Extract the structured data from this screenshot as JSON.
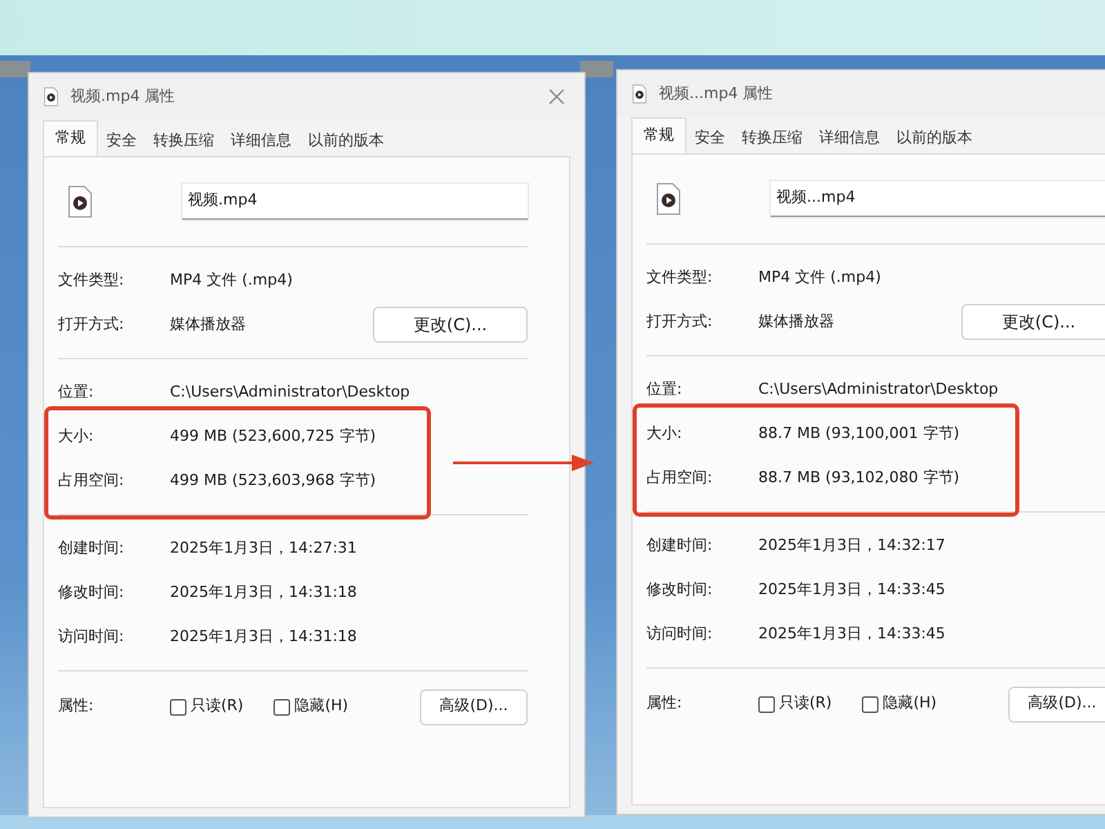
{
  "windows": [
    {
      "title": "视频.mp4 属性",
      "close_visible": true,
      "tabs": [
        {
          "label": "常规",
          "selected": true
        },
        {
          "label": "安全",
          "selected": false
        },
        {
          "label": "转换压缩",
          "selected": false
        },
        {
          "label": "详细信息",
          "selected": false
        },
        {
          "label": "以前的版本",
          "selected": false
        }
      ],
      "file_name": "视频.mp4",
      "sections": [
        [
          {
            "label": "文件类型:",
            "value": "MP4 文件 (.mp4)",
            "highlighted": false
          },
          {
            "label": "打开方式:",
            "value": "媒体播放器",
            "button": "更改(C)...",
            "highlighted": false
          }
        ],
        [
          {
            "label": "位置:",
            "value": "C:\\Users\\Administrator\\Desktop",
            "highlighted": false
          },
          {
            "label": "大小:",
            "value": "499 MB (523,600,725 字节)",
            "highlighted": true
          },
          {
            "label": "占用空间:",
            "value": "499 MB (523,603,968 字节)",
            "highlighted": true
          }
        ],
        [
          {
            "label": "创建时间:",
            "value": "2025年1月3日，14:27:31",
            "highlighted": false
          },
          {
            "label": "修改时间:",
            "value": "2025年1月3日，14:31:18",
            "highlighted": false
          },
          {
            "label": "访问时间:",
            "value": "2025年1月3日，14:31:18",
            "highlighted": false
          }
        ]
      ],
      "attributes": {
        "label": "属性:",
        "checkboxes": [
          {
            "label": "只读(R)",
            "checked": false
          },
          {
            "label": "隐藏(H)",
            "checked": false
          }
        ],
        "button": "高级(D)..."
      }
    },
    {
      "title": "视频...mp4 属性",
      "close_visible": false,
      "tabs": [
        {
          "label": "常规",
          "selected": true
        },
        {
          "label": "安全",
          "selected": false
        },
        {
          "label": "转换压缩",
          "selected": false
        },
        {
          "label": "详细信息",
          "selected": false
        },
        {
          "label": "以前的版本",
          "selected": false
        }
      ],
      "file_name": "视频...mp4",
      "sections": [
        [
          {
            "label": "文件类型:",
            "value": "MP4 文件 (.mp4)",
            "highlighted": false
          },
          {
            "label": "打开方式:",
            "value": "媒体播放器",
            "button": "更改(C)...",
            "highlighted": false
          }
        ],
        [
          {
            "label": "位置:",
            "value": "C:\\Users\\Administrator\\Desktop",
            "highlighted": false
          },
          {
            "label": "大小:",
            "value": "88.7 MB (93,100,001 字节)",
            "highlighted": true
          },
          {
            "label": "占用空间:",
            "value": "88.7 MB (93,102,080 字节)",
            "highlighted": true
          }
        ],
        [
          {
            "label": "创建时间:",
            "value": "2025年1月3日，14:32:17",
            "highlighted": false
          },
          {
            "label": "修改时间:",
            "value": "2025年1月3日，14:33:45",
            "highlighted": false
          },
          {
            "label": "访问时间:",
            "value": "2025年1月3日，14:33:45",
            "highlighted": false
          }
        ]
      ],
      "attributes": {
        "label": "属性:",
        "checkboxes": [
          {
            "label": "只读(R)",
            "checked": false
          },
          {
            "label": "隐藏(H)",
            "checked": false
          }
        ],
        "button": "高级(D)..."
      }
    }
  ],
  "annotation_arrow": true
}
